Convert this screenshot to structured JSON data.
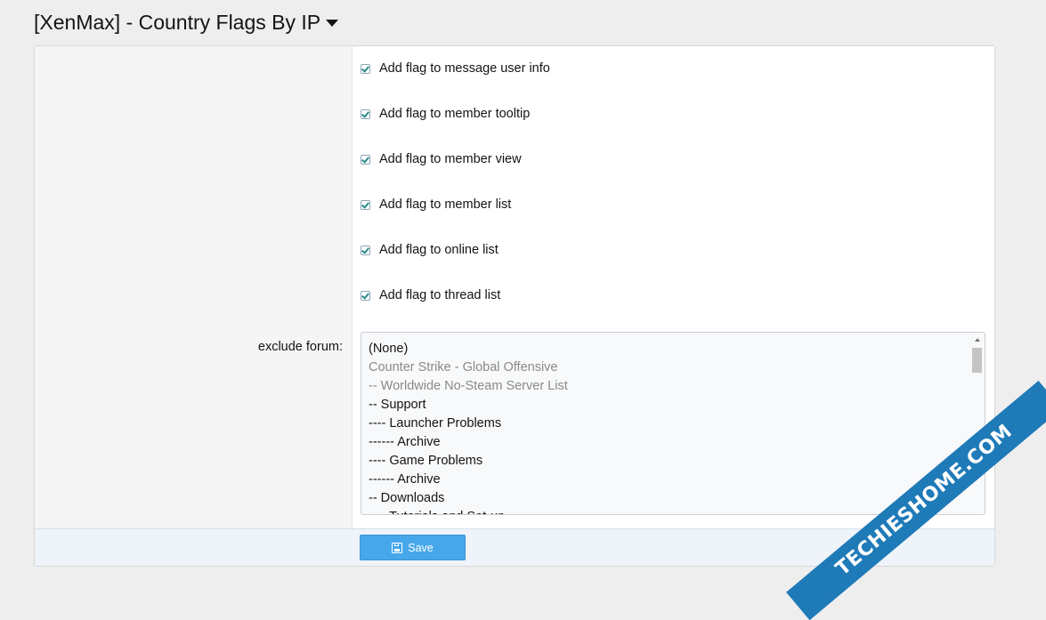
{
  "page": {
    "title": "[XenMax] - Country Flags By IP"
  },
  "options": [
    {
      "label": "Add flag to message user info",
      "checked": true
    },
    {
      "label": "Add flag to member tooltip",
      "checked": true
    },
    {
      "label": "Add flag to member view",
      "checked": true
    },
    {
      "label": "Add flag to member list",
      "checked": true
    },
    {
      "label": "Add flag to online list",
      "checked": true
    },
    {
      "label": "Add flag to thread list",
      "checked": true
    }
  ],
  "exclude_forum": {
    "label": "exclude forum:",
    "items": [
      {
        "text": "(None)",
        "dim": false
      },
      {
        "text": "Counter Strike - Global Offensive",
        "dim": true
      },
      {
        "text": "-- Worldwide No-Steam Server List",
        "dim": true
      },
      {
        "text": "-- Support",
        "dim": false
      },
      {
        "text": "---- Launcher Problems",
        "dim": false
      },
      {
        "text": "------ Archive",
        "dim": false
      },
      {
        "text": "---- Game Problems",
        "dim": false
      },
      {
        "text": "------ Archive",
        "dim": false
      },
      {
        "text": "-- Downloads",
        "dim": false
      },
      {
        "text": "---- Tutorials and Set-up",
        "dim": false
      }
    ]
  },
  "footer": {
    "save_label": "Save"
  },
  "watermark": {
    "text": "TECHIESHOME.COM"
  },
  "colors": {
    "accent": "#47a7eb",
    "checkmark": "#2e8a8a",
    "watermark": "#1f7ab8"
  }
}
